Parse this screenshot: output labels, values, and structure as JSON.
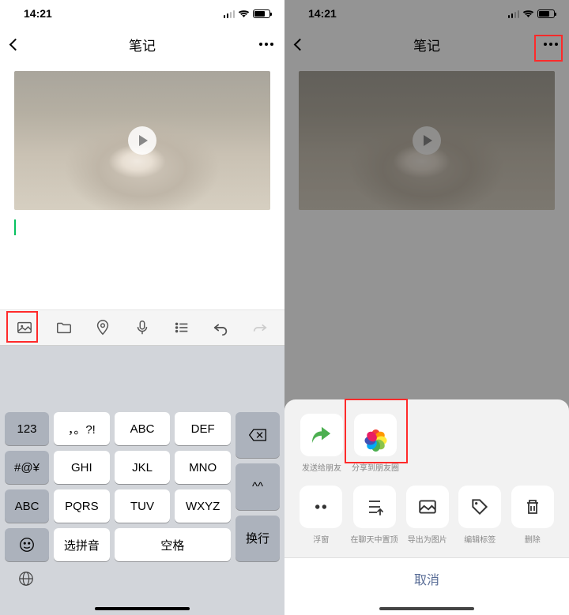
{
  "status": {
    "time": "14:21"
  },
  "nav": {
    "title": "笔记",
    "back_label": "back",
    "more_label": "more"
  },
  "toolbar": {
    "icons": [
      "image",
      "folder",
      "location",
      "mic",
      "list",
      "undo",
      "redo"
    ]
  },
  "keyboard": {
    "r1": [
      "123",
      "，。?!",
      "ABC",
      "DEF"
    ],
    "r2": [
      "#@¥",
      "GHI",
      "JKL",
      "MNO",
      "^^"
    ],
    "r3": [
      "ABC",
      "PQRS",
      "TUV",
      "WXYZ"
    ],
    "r4_left": "选拼音",
    "r4_mid": "空格",
    "enter": "换行",
    "emoji": "☺"
  },
  "sheet": {
    "row1": [
      {
        "label": "发送给朋友"
      },
      {
        "label": "分享到朋友圈"
      }
    ],
    "row2": [
      {
        "label": "浮窗"
      },
      {
        "label": "在聊天中置顶"
      },
      {
        "label": "导出为图片"
      },
      {
        "label": "编辑标签"
      },
      {
        "label": "删除"
      }
    ],
    "cancel": "取消"
  }
}
